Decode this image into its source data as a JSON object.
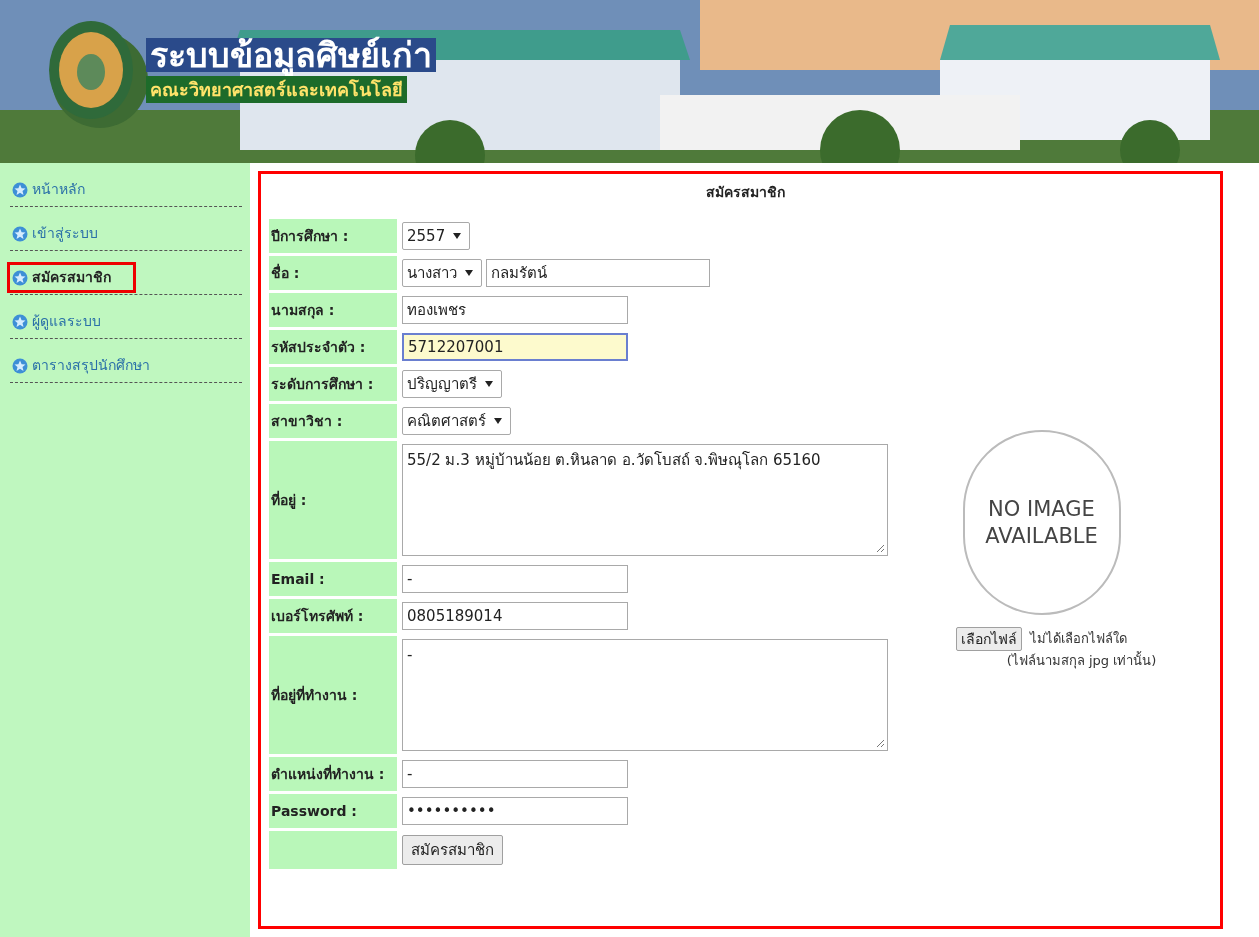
{
  "header": {
    "title": "ระบบข้อมูลศิษย์เก่า",
    "subtitle": "คณะวิทยาศาสตร์และเทคโนโลยี"
  },
  "sidebar": {
    "items": [
      {
        "label": "หน้าหลัก",
        "selected": false
      },
      {
        "label": "เข้าสู่ระบบ",
        "selected": false
      },
      {
        "label": "สมัครสมาชิก",
        "selected": true
      },
      {
        "label": "ผู้ดูแลระบบ",
        "selected": false
      },
      {
        "label": "ตารางสรุปนักศึกษา",
        "selected": false
      }
    ]
  },
  "form": {
    "title": "สมัครสมาชิก",
    "fields": [
      {
        "kind": "select",
        "label": "ปีการศึกษา :",
        "value": "2557"
      },
      {
        "kind": "name",
        "label": "ชื่อ :",
        "prefix": "นางสาว",
        "value": "กลมรัตน์"
      },
      {
        "kind": "input",
        "label": "นามสกุล :",
        "value": "ทองเพชร",
        "focused": false
      },
      {
        "kind": "input",
        "label": "รหัสประจำตัว :",
        "value": "5712207001",
        "focused": true
      },
      {
        "kind": "select",
        "label": "ระดับการศึกษา :",
        "value": "ปริญญาตรี"
      },
      {
        "kind": "select",
        "label": "สาขาวิชา :",
        "value": "คณิตศาสตร์"
      },
      {
        "kind": "textarea",
        "label": "ที่อยู่ :",
        "value": "55/2 ม.3 หมู่บ้านน้อย ต.หินลาด  อ.วัดโบสถ์  จ.พิษณุโลก  65160"
      },
      {
        "kind": "input",
        "label": "Email :",
        "value": "-",
        "focused": false
      },
      {
        "kind": "input",
        "label": "เบอร์โทรศัพท์ :",
        "value": "0805189014",
        "focused": false
      },
      {
        "kind": "textarea",
        "label": "ที่อยู่ที่ทำงาน :",
        "value": "-"
      },
      {
        "kind": "input",
        "label": "ตำแหน่งที่ทำงาน :",
        "value": "-",
        "focused": false
      },
      {
        "kind": "password",
        "label": "Password :",
        "value": "••••••••••"
      },
      {
        "kind": "submit",
        "button": "สมัครสมาชิก"
      }
    ],
    "photo": {
      "image_text": "NO IMAGE AVAILABLE",
      "choose_button": "เลือกไฟล์",
      "file_status": "ไม่ได้เลือกไฟล์ใด",
      "note": "(ไฟล์นามสกุล jpg เท่านั้น)"
    }
  }
}
